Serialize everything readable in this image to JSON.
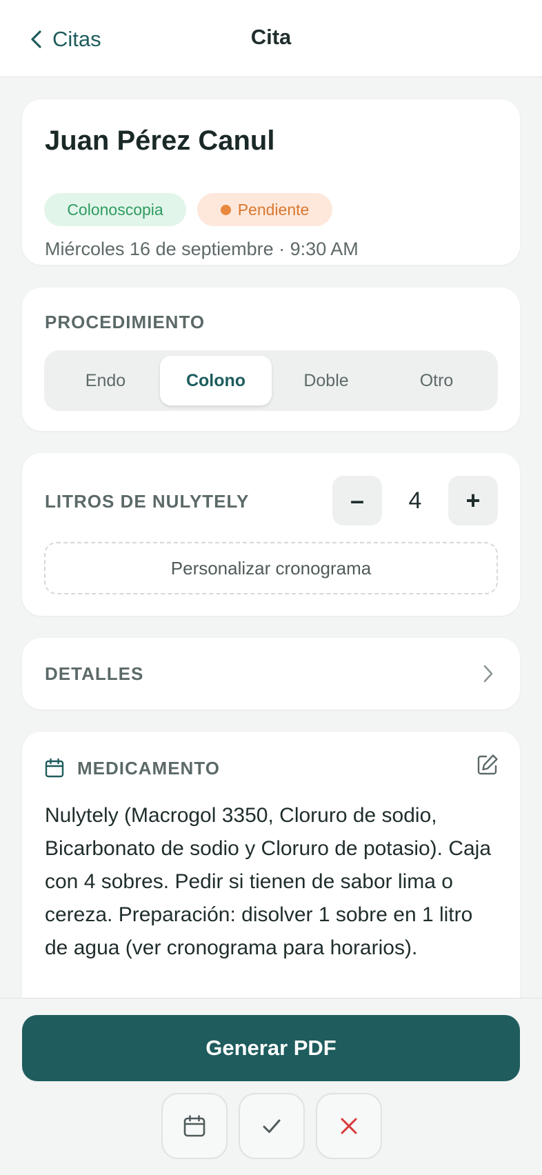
{
  "nav": {
    "back_label": "Citas",
    "title": "Cita"
  },
  "patient": {
    "name": "Juan Pérez Canul",
    "procedure_chip": "Colonoscopia",
    "status_chip": "Pendiente",
    "datetime": "Miércoles 16 de septiembre · 9:30 AM"
  },
  "procedure": {
    "label": "PROCEDIMIENTO",
    "options": [
      "Endo",
      "Colono",
      "Doble",
      "Otro"
    ],
    "selected": "Colono"
  },
  "liters": {
    "label": "LITROS DE NULYTELY",
    "minus": "–",
    "value": "4",
    "plus": "+",
    "customize_label": "Personalizar cronograma"
  },
  "details": {
    "label": "DETALLES"
  },
  "medication": {
    "label": "MEDICAMENTO",
    "text": "Nulytely (Macrogol 3350, Cloruro de sodio, Bicarbonato de sodio y Cloruro de potasio). Caja con 4 sobres. Pedir si tienen de sabor lima o cereza. Preparación: disolver 1 sobre en 1 litro de agua (ver cronograma para horarios)."
  },
  "footer": {
    "pdf_label": "Generar PDF",
    "actions": [
      "calendar-icon",
      "check-icon",
      "cancel-icon"
    ]
  },
  "colors": {
    "primary": "#1e5c5d",
    "success_bg": "#e2f5ea",
    "success_text": "#2e9b60",
    "warning_bg": "#fde8db",
    "warning_text": "#d9772f",
    "danger": "#d93a3a"
  }
}
